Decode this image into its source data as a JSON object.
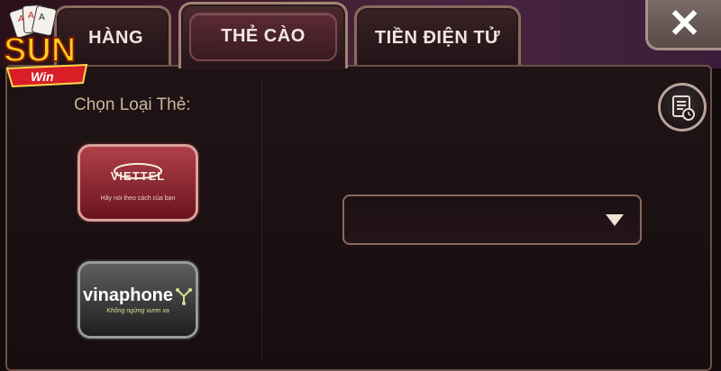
{
  "brand": {
    "logo_text": "SUN",
    "logo_subtext": "Win"
  },
  "tabs": [
    {
      "label": "HÀNG",
      "active": false
    },
    {
      "label": "THẺ CÀO",
      "active": true
    },
    {
      "label": "TIỀN ĐIỆN TỬ",
      "active": false
    }
  ],
  "close": {
    "icon": "close-icon",
    "glyph": "✕"
  },
  "card_section": {
    "label": "Chọn Loại Thẻ:",
    "carriers": [
      {
        "name": "VIETTEL",
        "slogan": "Hãy nói theo cách của bạn"
      },
      {
        "name": "vinaphone",
        "slogan": "Không ngừng vươn xa"
      }
    ]
  },
  "history_button": {
    "icon": "history-icon"
  },
  "denomination_select": {
    "value": ""
  },
  "colors": {
    "accent": "#8a6a5e",
    "panel_bg": "#1f1315",
    "label_text": "#c7b89a",
    "viettel_red": "#b0404a",
    "vina_grey": "#5e5e5e"
  }
}
